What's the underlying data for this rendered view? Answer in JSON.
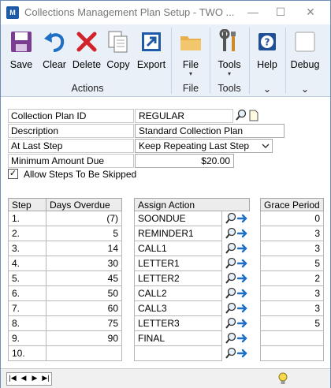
{
  "window": {
    "title": "Collections Management Plan Setup  -  TWO ...",
    "app_icon_text": "M"
  },
  "ribbon": {
    "actions_group_label": "Actions",
    "file_group_label": "File",
    "tools_group_label": "Tools",
    "buttons": {
      "save": "Save",
      "clear": "Clear",
      "delete": "Delete",
      "copy": "Copy",
      "export": "Export",
      "file": "File",
      "tools": "Tools",
      "help": "Help",
      "debug": "Debug"
    },
    "caret": "▾",
    "group_caret": "⌄"
  },
  "form": {
    "plan_id_label": "Collection Plan ID",
    "plan_id_value": "REGULAR",
    "description_label": "Description",
    "description_value": "Standard Collection Plan",
    "last_step_label": "At Last Step",
    "last_step_value": "Keep Repeating Last Step",
    "min_amount_label": "Minimum Amount Due",
    "min_amount_value": "$20.00",
    "allow_skip_label": "Allow Steps To Be Skipped",
    "allow_skip_checked": "✓"
  },
  "grid": {
    "headers": {
      "step": "Step",
      "days_overdue": "Days Overdue",
      "assign_action": "Assign Action",
      "grace_period": "Grace Period"
    },
    "rows": [
      {
        "step": "1.",
        "days": "(7)",
        "action": "SOONDUE",
        "grace": "0"
      },
      {
        "step": "2.",
        "days": "5",
        "action": "REMINDER1",
        "grace": "3"
      },
      {
        "step": "3.",
        "days": "14",
        "action": "CALL1",
        "grace": "3"
      },
      {
        "step": "4.",
        "days": "30",
        "action": "LETTER1",
        "grace": "5"
      },
      {
        "step": "5.",
        "days": "45",
        "action": "LETTER2",
        "grace": "2"
      },
      {
        "step": "6.",
        "days": "50",
        "action": "CALL2",
        "grace": "3"
      },
      {
        "step": "7.",
        "days": "60",
        "action": "CALL3",
        "grace": "3"
      },
      {
        "step": "8.",
        "days": "75",
        "action": "LETTER3",
        "grace": "5"
      },
      {
        "step": "9.",
        "days": "90",
        "action": "FINAL",
        "grace": ""
      },
      {
        "step": "10.",
        "days": "",
        "action": "",
        "grace": ""
      }
    ]
  },
  "statusbar": {
    "nav_first": "|◀",
    "nav_prev": "◀",
    "nav_next": "▶",
    "nav_last": "▶|"
  }
}
